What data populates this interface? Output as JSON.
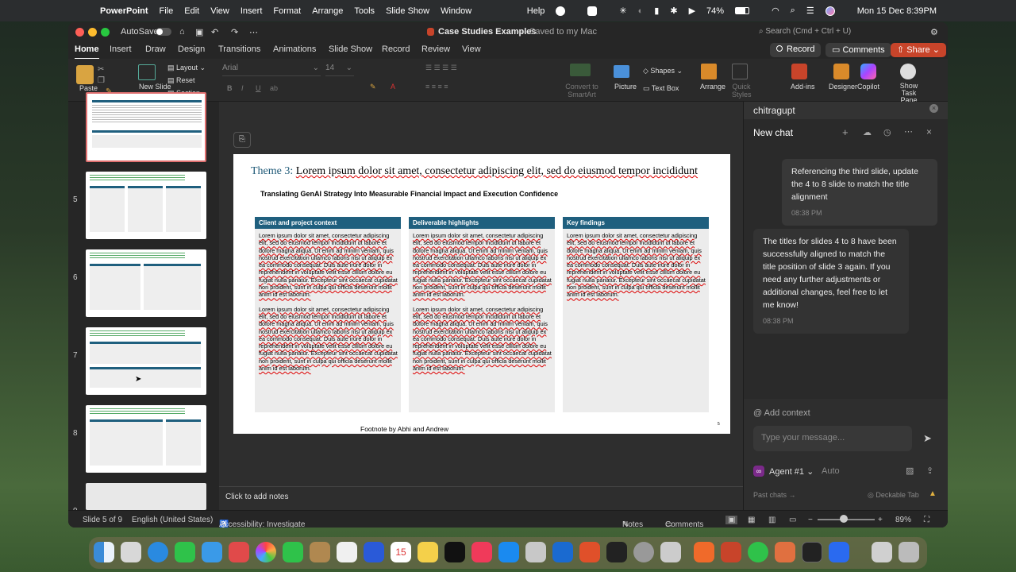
{
  "menubar": {
    "app": "PowerPoint",
    "items": [
      "File",
      "Edit",
      "View",
      "Insert",
      "Format",
      "Arrange",
      "Tools",
      "Slide Show",
      "Window"
    ],
    "help": "Help",
    "battery": "74%",
    "datetime": "Mon 15 Dec 8:39PM"
  },
  "window": {
    "autosave": "AutoSave",
    "doc_title": "Case Studies Examples",
    "saved_status": "— Saved to my Mac",
    "search_placeholder": "Search (Cmd + Ctrl + U)"
  },
  "ribbon_tabs": [
    "Home",
    "Insert",
    "Draw",
    "Design",
    "Transitions",
    "Animations",
    "Slide Show",
    "Record",
    "Review",
    "View"
  ],
  "ribbon_buttons": {
    "record": "Record",
    "comments": "Comments",
    "share": "Share",
    "paste": "Paste",
    "new_slide": "New Slide",
    "layout": "Layout",
    "reset": "Reset",
    "section": "Section",
    "font": "Arial",
    "font_size": "14",
    "convert": "Convert to SmartArt",
    "picture": "Picture",
    "shapes": "Shapes",
    "textbox": "Text Box",
    "arrange": "Arrange",
    "quick_styles": "Quick Styles",
    "addins": "Add-ins",
    "designer": "Designer",
    "copilot": "Copilot",
    "show_task_pane": "Show Task Pane"
  },
  "thumbnails": [
    "5",
    "6",
    "7",
    "8",
    "9"
  ],
  "slide": {
    "theme_label": "Theme 3:",
    "title": "Lorem ipsum dolor sit amet, consectetur adipiscing elit, sed do eiusmod tempor incididunt",
    "subtitle": "Translating GenAI Strategy Into Measurable Financial Impact and Execution Confidence",
    "columns": [
      {
        "heading": "Client and project context",
        "paragraphs": [
          "Lorem ipsum dolor sit amet, consectetur adipiscing elit, sed do eiusmod tempor incididunt ut labore et dolore magna aliqua. Ut enim ad minim veniam, quis nostrud exercitation ullamco laboris nisi ut aliquip ex ea commodo consequat. Duis aute irure dolor in reprehenderit in voluptate velit esse cillum dolore eu fugiat nulla pariatur. Excepteur sint occaecat cupidatat non proident, sunt in culpa qui officia deserunt mollit anim id est laborum.",
          "Lorem ipsum dolor sit amet, consectetur adipiscing elit, sed do eiusmod tempor incididunt ut labore et dolore magna aliqua. Ut enim ad minim veniam, quis nostrud exercitation ullamco laboris nisi ut aliquip ex ea commodo consequat. Duis aute irure dolor in reprehenderit in voluptate velit esse cillum dolore eu fugiat nulla pariatur. Excepteur sint occaecat cupidatat non proident, sunt in culpa qui officia deserunt mollit anim id est laborum."
        ]
      },
      {
        "heading": "Deliverable highlights",
        "paragraphs": [
          "Lorem ipsum dolor sit amet, consectetur adipiscing elit, sed do eiusmod tempor incididunt ut labore et dolore magna aliqua. Ut enim ad minim veniam, quis nostrud exercitation ullamco laboris nisi ut aliquip ex ea commodo consequat. Duis aute irure dolor in reprehenderit in voluptate velit esse cillum dolore eu fugiat nulla pariatur. Excepteur sint occaecat cupidatat non proident, sunt in culpa qui officia deserunt mollit anim id est laborum.",
          "Lorem ipsum dolor sit amet, consectetur adipiscing elit, sed do eiusmod tempor incididunt ut labore et dolore magna aliqua. Ut enim ad minim veniam, quis nostrud exercitation ullamco laboris nisi ut aliquip ex ea commodo consequat. Duis aute irure dolor in reprehenderit in voluptate velit esse cillum dolore eu fugiat nulla pariatur. Excepteur sint occaecat cupidatat non proident, sunt in culpa qui officia deserunt mollit anim id est laborum."
        ]
      },
      {
        "heading": "Key findings",
        "paragraphs": [
          "Lorem ipsum dolor sit amet, consectetur adipiscing elit, sed do eiusmod tempor incididunt ut labore et dolore magna aliqua. Ut enim ad minim veniam, quis nostrud exercitation ullamco laboris nisi ut aliquip ex ea commodo consequat. Duis aute irure dolor in reprehenderit in voluptate velit esse cillum dolore eu fugiat nulla pariatur. Excepteur sint occaecat cupidatat non proident, sunt in culpa qui officia deserunt mollit anim id est laborum."
        ]
      }
    ],
    "footnote": "Footnote by Abhi and Andrew",
    "page_number": "5"
  },
  "notes_placeholder": "Click to add notes",
  "chat": {
    "workspace": "chitragupt",
    "title": "New chat",
    "messages": [
      {
        "role": "user",
        "text": "Referencing the third slide, update the 4 to 8 slide to match the title alignment",
        "time": "08:38 PM"
      },
      {
        "role": "assistant",
        "text": "The titles for slides 4 to 8 have been successfully aligned to match the title position of slide 3 again. If you need any further adjustments or additional changes, feel free to let me know!",
        "time": "08:38 PM"
      }
    ],
    "add_context": "Add context",
    "input_placeholder": "Type your message...",
    "agent": "Agent #1",
    "mode": "Auto",
    "past_chats": "Past chats →",
    "deckable_tab": "Deckable Tab"
  },
  "statusbar": {
    "slide_info": "Slide 5 of 9",
    "language": "English (United States)",
    "accessibility": "Accessibility: Investigate",
    "notes": "Notes",
    "comments": "Comments",
    "zoom": "89%"
  },
  "colors": {
    "accent_share": "#c8442a",
    "column_header": "#1f5f7e",
    "theme_label": "#1f5a78"
  }
}
